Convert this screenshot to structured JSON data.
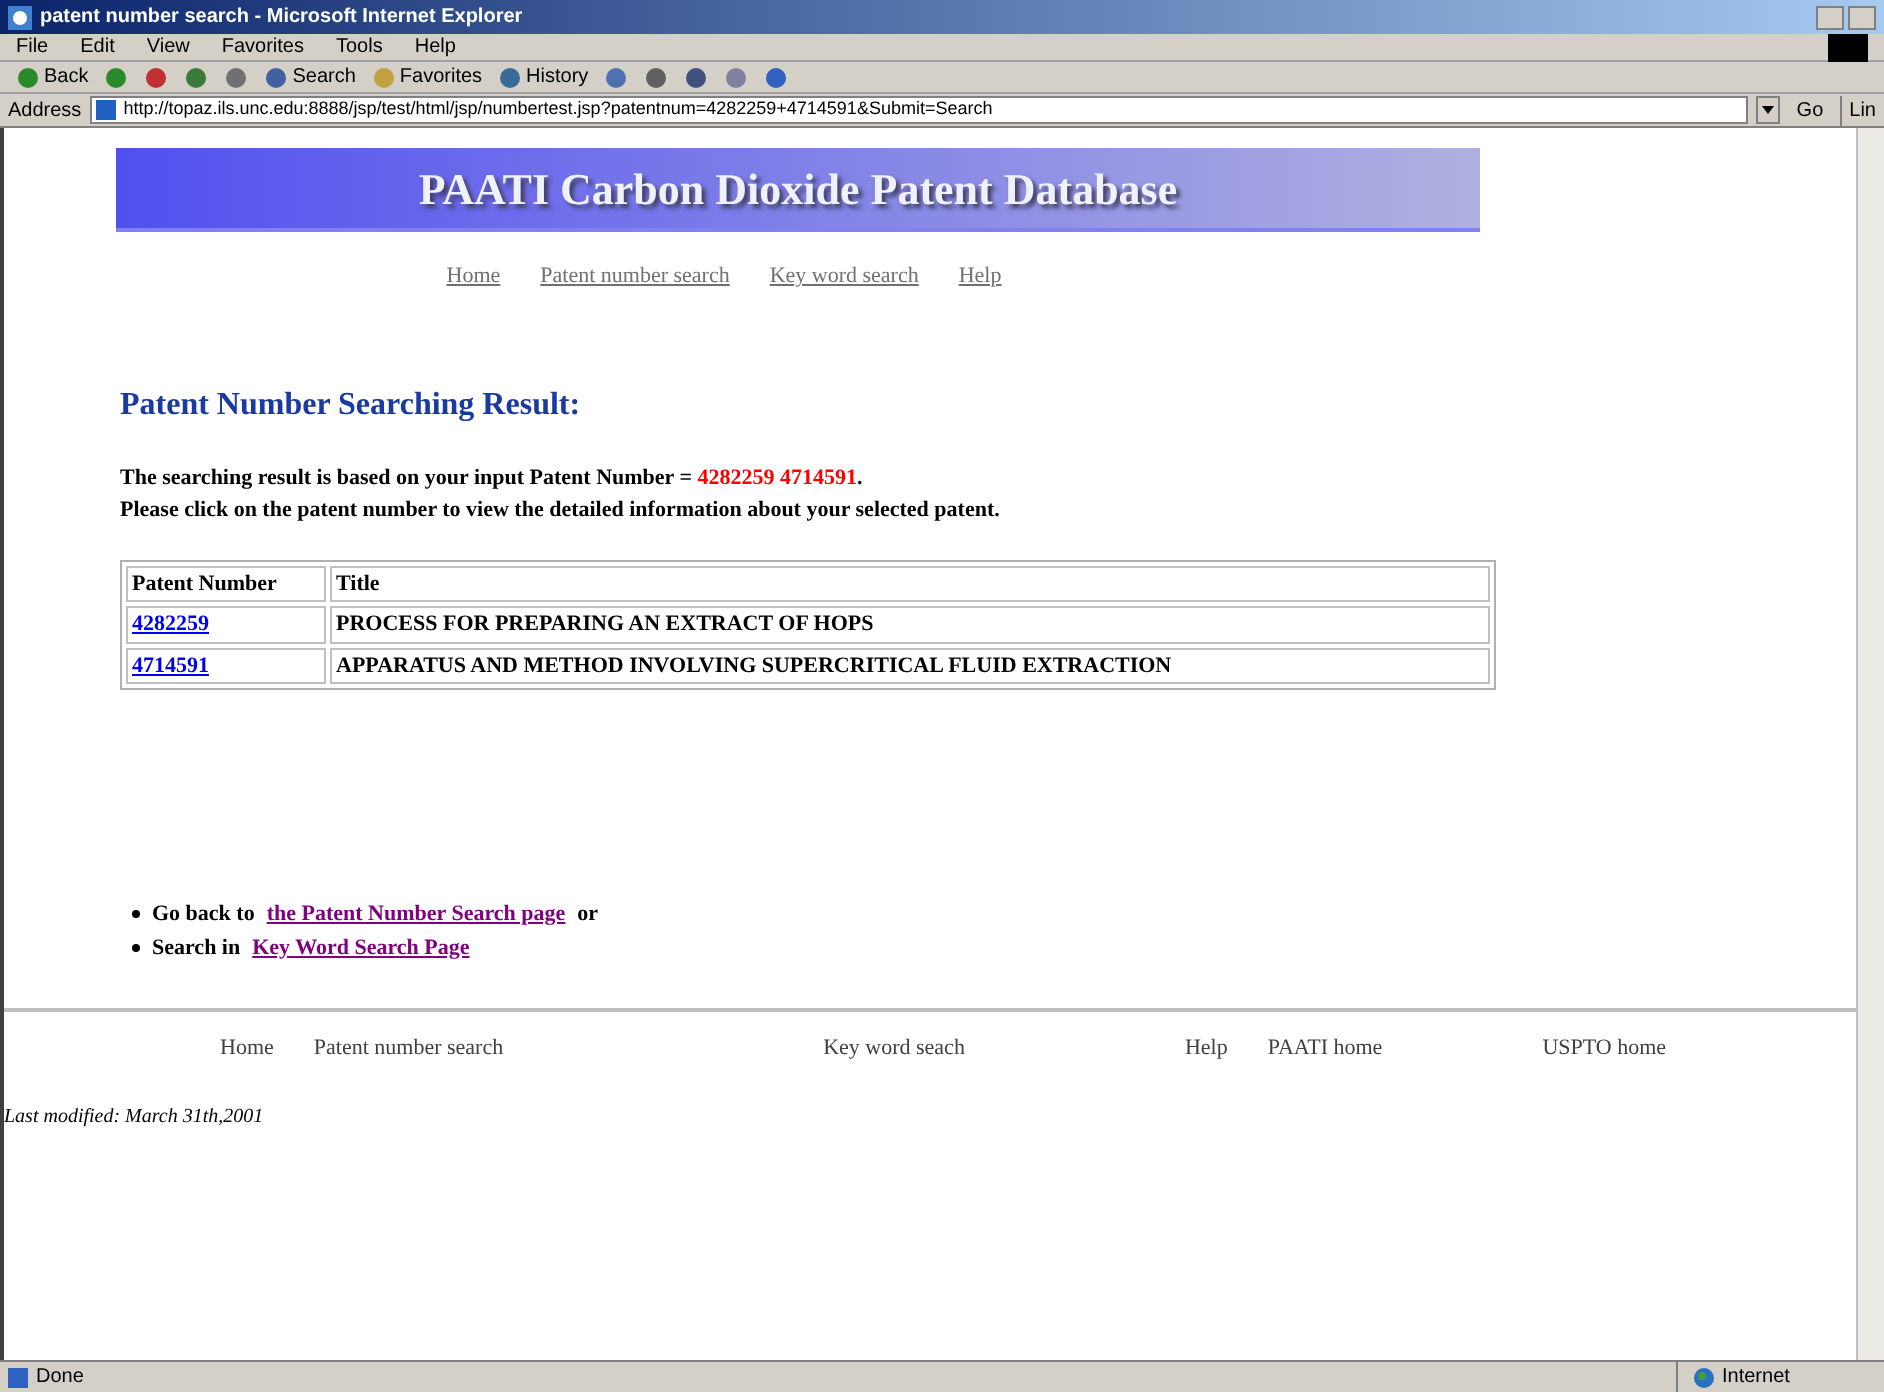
{
  "window": {
    "title": "patent number search - Microsoft Internet Explorer"
  },
  "menu_bar": [
    "File",
    "Edit",
    "View",
    "Favorites",
    "Tools",
    "Help"
  ],
  "toolbar": [
    {
      "kind": "back",
      "label": "Back"
    },
    {
      "kind": "forward"
    },
    {
      "kind": "stop"
    },
    {
      "kind": "refresh"
    },
    {
      "kind": "home"
    },
    {
      "kind": "search",
      "label": "Search"
    },
    {
      "kind": "favorites",
      "label": "Favorites"
    },
    {
      "kind": "history",
      "label": "History"
    },
    {
      "kind": "mail"
    },
    {
      "kind": "print"
    },
    {
      "kind": "edit"
    },
    {
      "kind": "discuss"
    },
    {
      "kind": "messenger"
    }
  ],
  "address_bar": {
    "label": "Address",
    "value": "http://topaz.ils.unc.edu:8888/jsp/test/html/jsp/numbertest.jsp?patentnum=4282259+4714591&Submit=Search",
    "go": "Go",
    "links": "Lin"
  },
  "page": {
    "banner": "PAATI Carbon Dioxide Patent Database",
    "nav_links": [
      "Home",
      "Patent number search",
      "Key word search",
      "Help"
    ],
    "heading": "Patent Number Searching Result:",
    "intro": {
      "text": "The searching result is based on your input Patent Number = ",
      "numbers": "4282259 4714591",
      "end": "."
    },
    "instruction": "Please click on the patent number to view the detailed information about your selected patent.",
    "table": {
      "columns": [
        "Patent Number",
        "Title"
      ],
      "rows": [
        {
          "number": "4282259",
          "title": "PROCESS FOR PREPARING AN EXTRACT OF HOPS"
        },
        {
          "number": "4714591",
          "title": "APPARATUS AND METHOD INVOLVING SUPERCRITICAL FLUID EXTRACTION"
        }
      ]
    },
    "bullets": [
      {
        "text": "Go back to",
        "link": "the Patent Number Search page",
        "after": "or"
      },
      {
        "text": "Search in",
        "link": "Key Word Search Page"
      }
    ],
    "footer_links": [
      "Home",
      "Patent number search",
      "Key word seach",
      "Help",
      "PAATI home",
      "USPTO home"
    ],
    "last_modified": "Last modified: March 31th,2001"
  },
  "status_bar": {
    "text": "Done",
    "zone": "Internet"
  }
}
